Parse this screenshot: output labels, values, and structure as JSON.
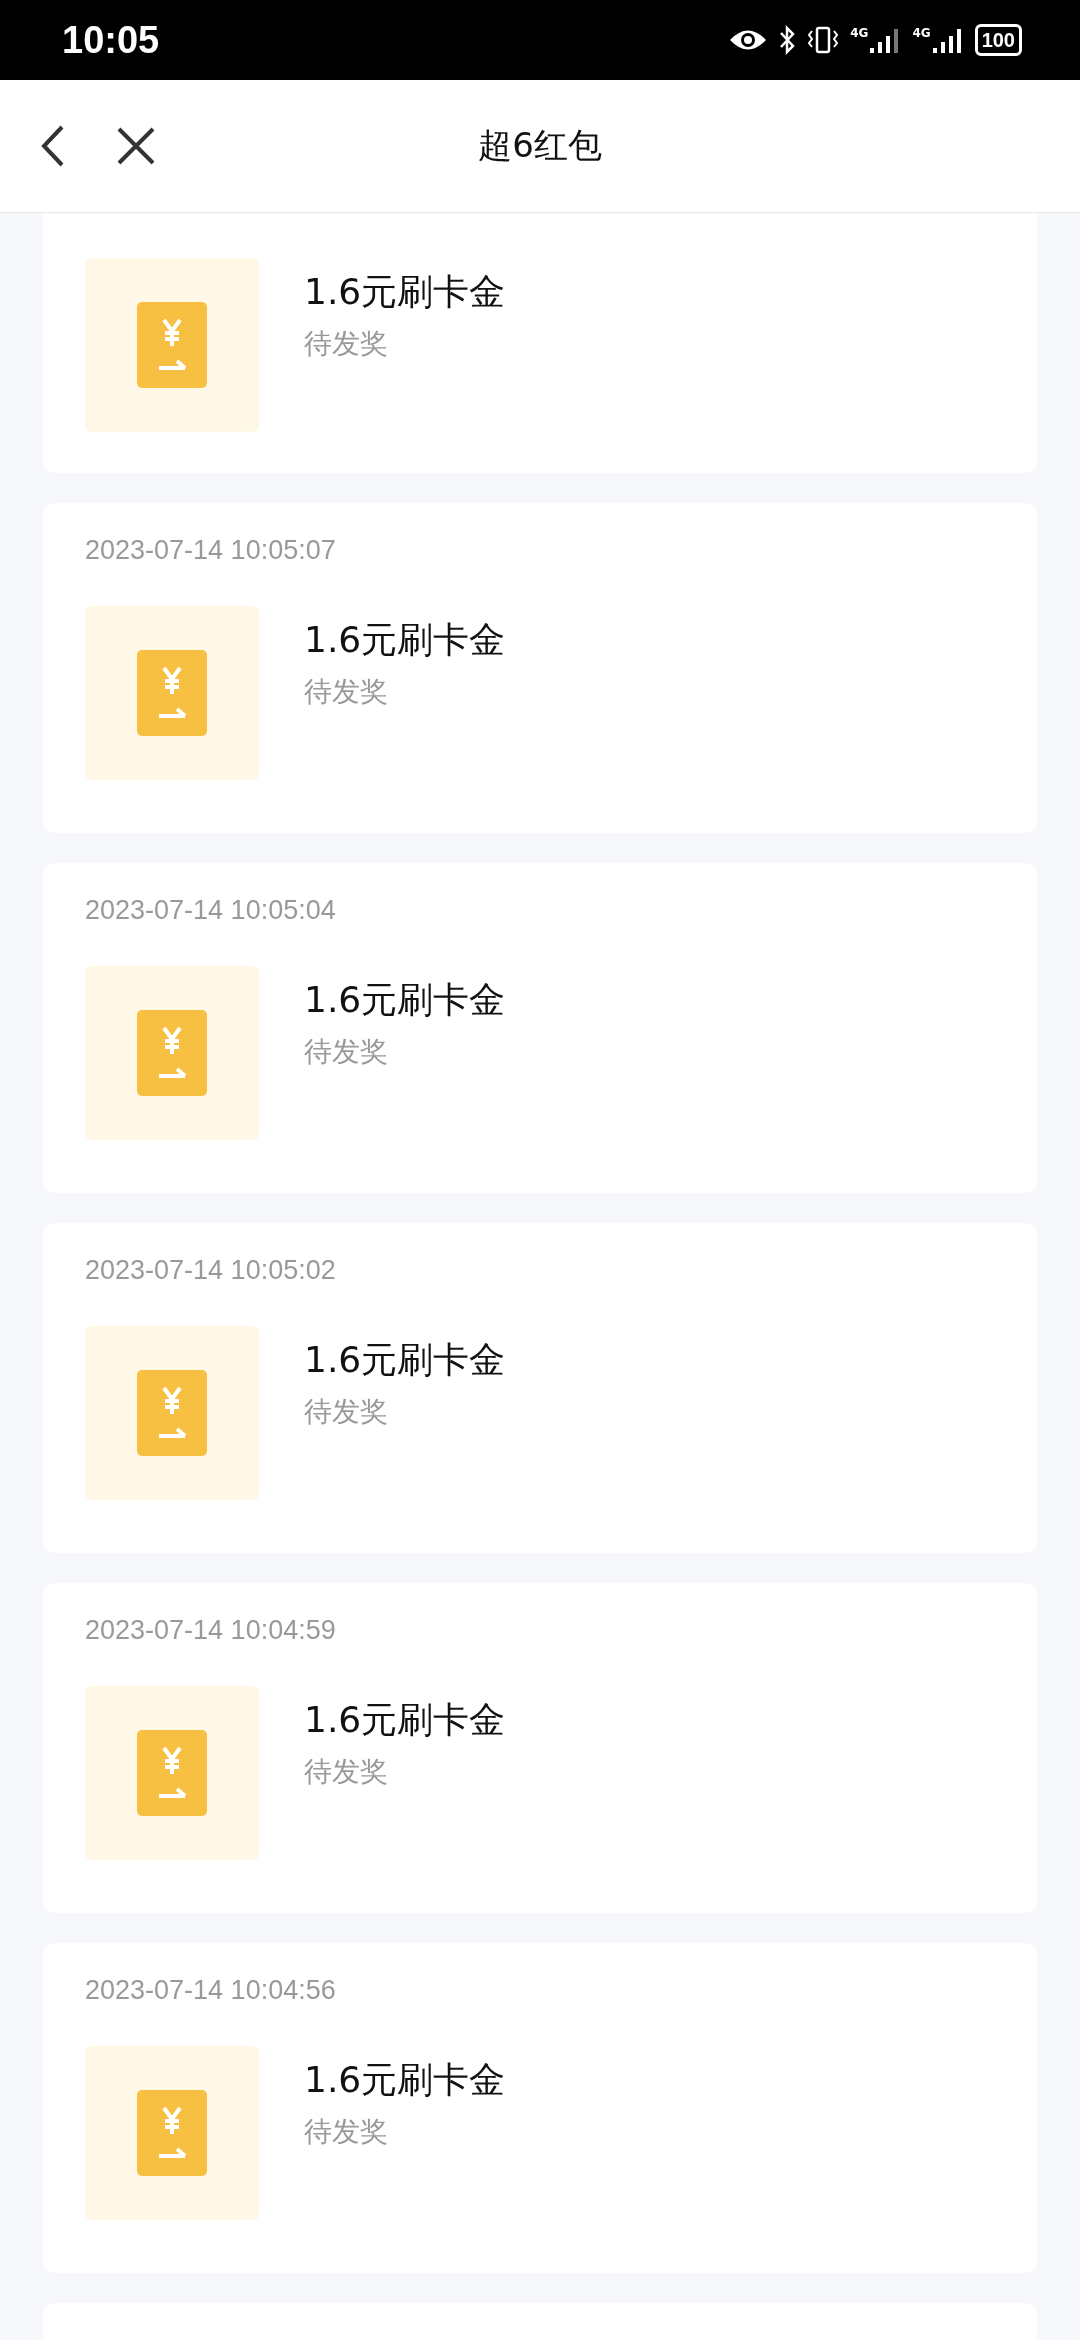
{
  "status_bar": {
    "time": "10:05",
    "networks": [
      "4G",
      "4G"
    ],
    "battery": "100"
  },
  "header": {
    "title": "超6红包"
  },
  "records": [
    {
      "title": "1.6元刷卡金",
      "status": "待发奖"
    },
    {
      "date": "2023-07-14 10:05:07",
      "title": "1.6元刷卡金",
      "status": "待发奖"
    },
    {
      "date": "2023-07-14 10:05:04",
      "title": "1.6元刷卡金",
      "status": "待发奖"
    },
    {
      "date": "2023-07-14 10:05:02",
      "title": "1.6元刷卡金",
      "status": "待发奖"
    },
    {
      "date": "2023-07-14 10:04:59",
      "title": "1.6元刷卡金",
      "status": "待发奖"
    },
    {
      "date": "2023-07-14 10:04:56",
      "title": "1.6元刷卡金",
      "status": "待发奖"
    },
    {
      "kind": "partial"
    }
  ]
}
